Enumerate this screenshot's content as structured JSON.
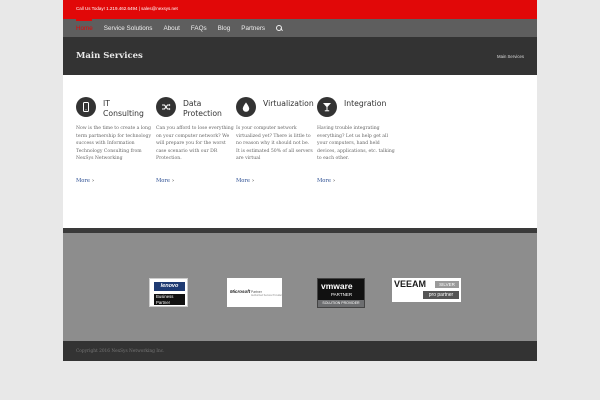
{
  "topbar": {
    "contact": "Call Us Today! 1.219.462.6494  |  sales@nexsys.net"
  },
  "nav": {
    "items": [
      {
        "label": "Home",
        "active": true
      },
      {
        "label": "Service Solutions",
        "active": false
      },
      {
        "label": "About",
        "active": false
      },
      {
        "label": "FAQs",
        "active": false
      },
      {
        "label": "Blog",
        "active": false
      },
      {
        "label": "Partners",
        "active": false
      }
    ],
    "search_icon": "search-icon"
  },
  "page_title": {
    "title": "Main Services",
    "breadcrumb": "Main Services"
  },
  "services": [
    {
      "title_line1": "IT",
      "title_line2": "Consulting",
      "icon": "mobile-icon",
      "text": "Now is the time to create a long term partnership for technology success with Information Technology Consulting from NexSys Networking",
      "more": "More"
    },
    {
      "title_line1": "Data",
      "title_line2": "Protection",
      "icon": "shuffle-icon",
      "text": "Can you afford to lose everything on your computer network? We will prepare you for the worst case scenario with our DR Protection.",
      "more": "More"
    },
    {
      "title_line1": "Virtualization",
      "title_line2": "",
      "icon": "tint-icon",
      "text": "Is your computer network virtualized yet? There is little to no reason why it should not be. It is estimated 50% of all servers are virtual",
      "more": "More"
    },
    {
      "title_line1": "Integration",
      "title_line2": "",
      "icon": "glass-icon",
      "text": "Having trouble integrating everything? Let us help get all your computers, hand held devices, applications, etc. talking to each other.",
      "more": "More"
    }
  ],
  "partners": {
    "lenovo": {
      "brand": "lenovo",
      "line1": "Business",
      "line2": "Partner"
    },
    "microsoft": {
      "brand": "Microsoft",
      "label": "Partner",
      "fine": "Authorized Service Provider"
    },
    "vmware": {
      "brand": "vmware",
      "label": "PARTNER",
      "tier": "SOLUTION PROVIDER"
    },
    "veeam": {
      "brand": "VEEAM",
      "tier": "SILVER",
      "label": "pro partner"
    }
  },
  "footer": {
    "copyright": "Copyright 2016 NexSys Networking Inc."
  },
  "colors": {
    "accent": "#e10808",
    "nav_bg": "#5e5e5e",
    "title_bg": "#333333",
    "partners_bg": "#8d8d8d",
    "link": "#2b4e92"
  }
}
